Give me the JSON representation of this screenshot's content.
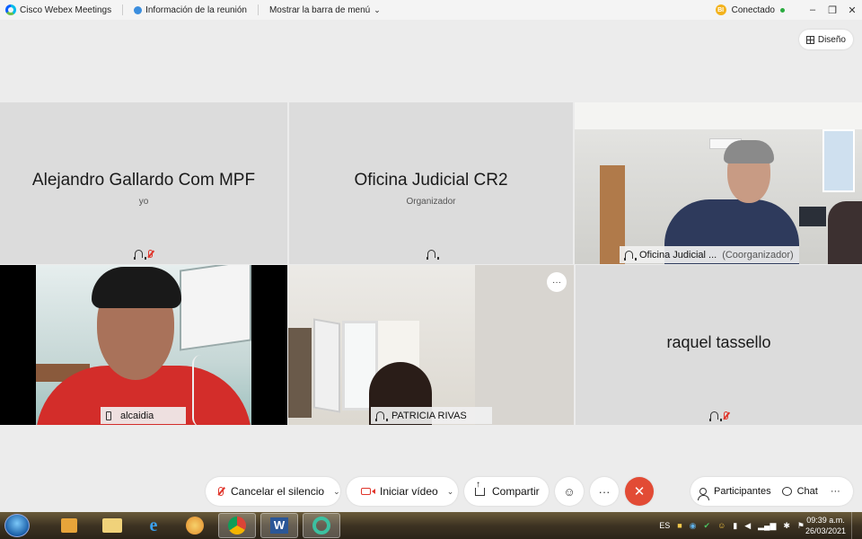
{
  "topbar": {
    "app_title": "Cisco Webex Meetings",
    "meeting_info": "Información de la reunión",
    "menu_toggle": "Mostrar la barra de menú",
    "connection_badge": "BI",
    "connection_status": "Conectado",
    "minimize": "–",
    "restore": "❐",
    "close": "✕"
  },
  "layout_button": "Diseño",
  "tiles": {
    "t1": {
      "name": "Alejandro Gallardo Com MPF",
      "sub": "yo"
    },
    "t2": {
      "name": "Oficina Judicial CR2",
      "sub": "Organizador"
    },
    "t3": {
      "name": "Oficina Judicial ...",
      "role": "(Coorganizador)"
    },
    "t4": {
      "name": "alcaidia"
    },
    "t5": {
      "name": "PATRICIA RIVAS",
      "more": "···"
    },
    "t6": {
      "name": "raquel tassello"
    }
  },
  "controls": {
    "unmute": "Cancelar el silencio",
    "start_video": "Iniciar vídeo",
    "share": "Compartir",
    "reactions": "☺",
    "more": "···",
    "end": "✕",
    "participants": "Participantes",
    "chat": "Chat",
    "more_right": "···",
    "caret": "⌄"
  },
  "taskbar": {
    "lang": "ES",
    "time": "09:39 a.m.",
    "date": "26/03/2021",
    "apps": [
      "media-player",
      "file-explorer",
      "internet-explorer",
      "paint",
      "chrome",
      "word",
      "webex"
    ]
  }
}
